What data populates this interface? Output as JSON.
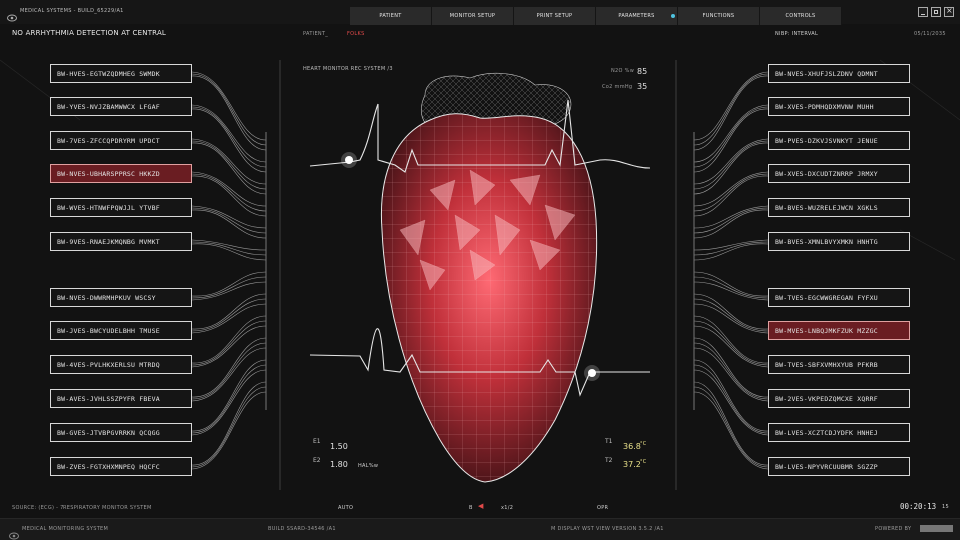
{
  "window": {
    "title": "MEDICAL SYSTEMS - BUILD_65229/A1"
  },
  "nav": {
    "tabs": [
      "PATIENT",
      "MONITOR SETUP",
      "PRINT SETUP",
      "PARAMETERS",
      "FUNCTIONS",
      "CONTROLS"
    ]
  },
  "header": {
    "alert": "NO ARRHYTHMIA DETECTION AT CENTRAL",
    "patient_label": "PATIENT_",
    "patient_tag": "FOLKS",
    "nibp": "NIBP: INTERVAL",
    "date": "05/11/2035"
  },
  "monitor": {
    "title": "HEART MONITOR REC SYSTEM /3",
    "n2o_label": "N2O %w",
    "n2o_value": "85",
    "co2_label": "Co2 mmHg",
    "co2_value": "35",
    "e1_label": "E1",
    "e1_value": "1.50",
    "e2_label": "E2",
    "e2_value": "1.80",
    "hal_label": "HAL%w",
    "t1_label": "T1",
    "t1_value": "36.8",
    "t2_label": "T2",
    "t2_value": "37.2",
    "temp_unit": "°C"
  },
  "left_list": [
    {
      "label": "BW-HVES-EGTWZQDMHEG SWMDK",
      "highlighted": false
    },
    {
      "label": "BW-YVES-NVJZBAMWWCX LFGAF",
      "highlighted": false
    },
    {
      "label": "BW-7VES-ZFCCQPDRYRM UPDCT",
      "highlighted": false
    },
    {
      "label": "BW-NVES-UBHARSPPRSC HKKZD",
      "highlighted": true
    },
    {
      "label": "BW-WVES-HTNWFPQWJJL YTVBF",
      "highlighted": false
    },
    {
      "label": "BW-9VES-RNAEJKMQNBG MVMKT",
      "highlighted": false
    },
    {
      "label": "BW-NVES-DWWRMHPKUV WSCSY",
      "highlighted": false
    },
    {
      "label": "BW-JVES-BWCYUDELBHH TMUSE",
      "highlighted": false
    },
    {
      "label": "BW-4VES-PVLHKXERLSU MTRDQ",
      "highlighted": false
    },
    {
      "label": "BW-AVES-JVHLSSZPYFR FBEVA",
      "highlighted": false
    },
    {
      "label": "BW-GVES-JTVBPGVRRKN QCQGG",
      "highlighted": false
    },
    {
      "label": "BW-ZVES-FGTXHXMNPEQ HQCFC",
      "highlighted": false
    }
  ],
  "right_list": [
    {
      "label": "BW-NVES-XHUFJSLZDNV QDMNT",
      "highlighted": false
    },
    {
      "label": "BW-XVES-PDMHQDXMVNW MUHH",
      "highlighted": false
    },
    {
      "label": "BW-PVES-DZKVJSVNKYT JENUE",
      "highlighted": false
    },
    {
      "label": "BW-XVES-DXCUDTZNRRP JRMXY",
      "highlighted": false
    },
    {
      "label": "BW-BVES-WUZRELEJWCN XGKLS",
      "highlighted": false
    },
    {
      "label": "BW-BVES-XMNLBVYXMKN HNHTG",
      "highlighted": false
    },
    {
      "label": "BW-TVES-EGCWWGREGAN FYFXU",
      "highlighted": false
    },
    {
      "label": "BW-MVES-LNBQJMKFZUK MZZGC",
      "highlighted": true
    },
    {
      "label": "BW-TVES-SBFXVMHXYUB PFKRB",
      "highlighted": false
    },
    {
      "label": "BW-2VES-VKPEDZQMCXE XQRRF",
      "highlighted": false
    },
    {
      "label": "BW-LVES-XCZTCDJYDFK HNHEJ",
      "highlighted": false
    },
    {
      "label": "BW-LVES-NPYVRCUUBMR SGZZP",
      "highlighted": false
    }
  ],
  "footer": {
    "source": "SOURCE: (ECG) - 7",
    "system": "RESPIRATORY MONITOR SYSTEM",
    "auto": "AUTO",
    "b": "B",
    "speed": "x1/2",
    "opr": "OPR",
    "timer": "00:20:13",
    "timer_page": "15"
  },
  "statusbar": {
    "app": "MEDICAL MONITORING SYSTEM",
    "build": "BUILD SSARD-34546 /A1",
    "version": "M DISPLAY WST VIEW VERSION 3.5.2 /A1",
    "powered": "POWERED BY"
  },
  "colors": {
    "highlight": "#6a1d22",
    "heart": "#d9333f",
    "temp": "#e8e08a"
  }
}
